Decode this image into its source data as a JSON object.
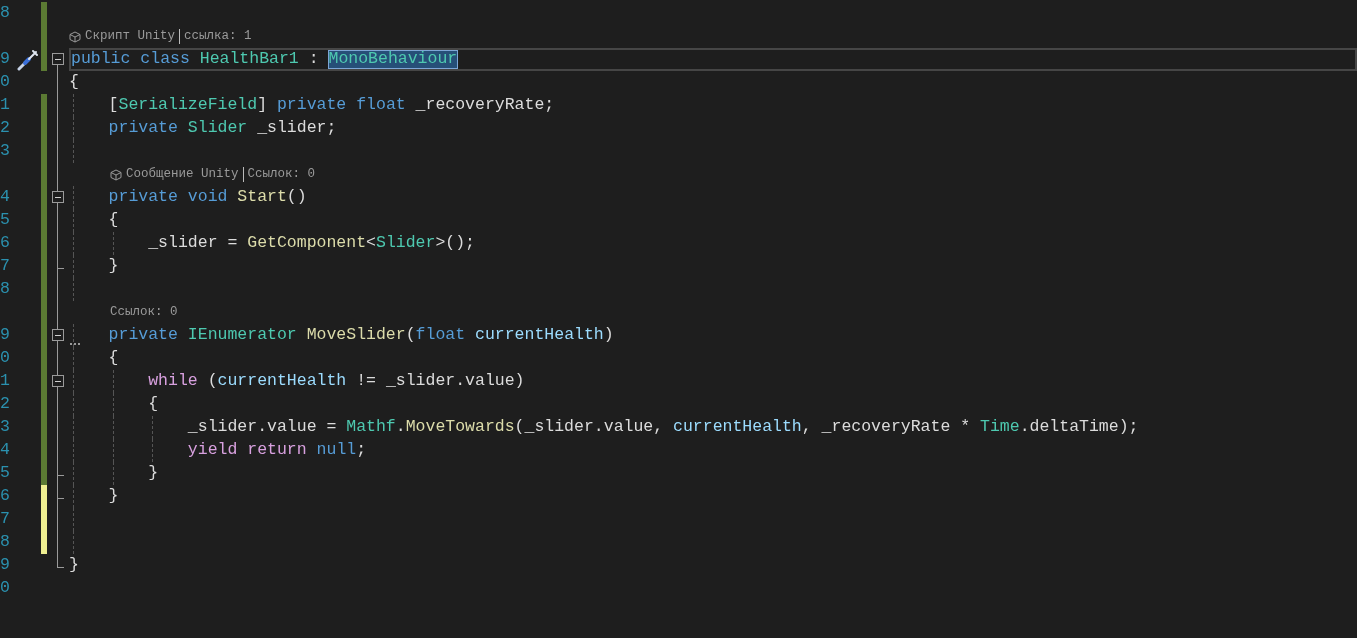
{
  "editor": {
    "rows": [
      {
        "kind": "code",
        "number": "8",
        "changed": true,
        "unsaved": false,
        "collapsible": false,
        "in_block": false,
        "block_end": false,
        "tokens": []
      },
      {
        "kind": "lens",
        "changed": true,
        "unsaved": false,
        "collapsible": false,
        "in_block": false,
        "block_end": false,
        "icon": true,
        "indented": false,
        "parts": [
          "Скрипт Unity",
          "ссылка: 1"
        ]
      },
      {
        "kind": "code",
        "number": "9",
        "changed": true,
        "unsaved": false,
        "collapsible": true,
        "in_block": false,
        "block_end": false,
        "current": true,
        "quick_action": true,
        "tokens": [
          {
            "kind": "keyword",
            "s": "public"
          },
          {
            "kind": "keyword",
            "s": " class"
          },
          {
            "kind": "type",
            "s": " HealthBar1"
          },
          {
            "kind": "plain",
            "s": " : "
          },
          {
            "kind": "type",
            "s": "MonoBehaviour",
            "highlighted": true
          }
        ]
      },
      {
        "kind": "code",
        "number": "0",
        "changed": false,
        "unsaved": false,
        "collapsible": false,
        "in_block": true,
        "block_end": false,
        "tokens": [
          {
            "kind": "plain",
            "s": "{"
          }
        ]
      },
      {
        "kind": "code",
        "number": "1",
        "changed": true,
        "unsaved": false,
        "collapsible": false,
        "in_block": true,
        "block_end": false,
        "tokens": [
          {
            "kind": "plain",
            "s": "    ["
          },
          {
            "kind": "type",
            "s": "SerializeField"
          },
          {
            "kind": "plain",
            "s": "]"
          },
          {
            "kind": "keyword",
            "s": " private"
          },
          {
            "kind": "keyword",
            "s": " float"
          },
          {
            "kind": "plain",
            "s": " _recoveryRate;"
          }
        ]
      },
      {
        "kind": "code",
        "number": "2",
        "changed": true,
        "unsaved": false,
        "collapsible": false,
        "in_block": true,
        "block_end": false,
        "tokens": [
          {
            "kind": "keyword",
            "s": "    private"
          },
          {
            "kind": "type",
            "s": " Slider"
          },
          {
            "kind": "plain",
            "s": " _slider;"
          }
        ]
      },
      {
        "kind": "code",
        "number": "3",
        "changed": true,
        "unsaved": false,
        "collapsible": false,
        "in_block": true,
        "block_end": false,
        "tokens": []
      },
      {
        "kind": "lens",
        "changed": true,
        "unsaved": false,
        "collapsible": false,
        "in_block": true,
        "block_end": false,
        "icon": true,
        "indented": true,
        "parts": [
          "Сообщение Unity",
          "Ссылок: 0"
        ]
      },
      {
        "kind": "code",
        "number": "4",
        "changed": true,
        "unsaved": false,
        "collapsible": true,
        "in_block": true,
        "block_end": false,
        "tokens": [
          {
            "kind": "keyword",
            "s": "    private"
          },
          {
            "kind": "keyword",
            "s": " void"
          },
          {
            "kind": "method",
            "s": " Start"
          },
          {
            "kind": "plain",
            "s": "()"
          }
        ]
      },
      {
        "kind": "code",
        "number": "5",
        "changed": true,
        "unsaved": false,
        "collapsible": false,
        "in_block": true,
        "block_end": false,
        "tokens": [
          {
            "kind": "plain",
            "s": "    {"
          }
        ]
      },
      {
        "kind": "code",
        "number": "6",
        "changed": true,
        "unsaved": false,
        "collapsible": false,
        "in_block": true,
        "block_end": false,
        "tokens": [
          {
            "kind": "plain",
            "s": "        _slider = "
          },
          {
            "kind": "method",
            "s": "GetComponent"
          },
          {
            "kind": "plain",
            "s": "<"
          },
          {
            "kind": "type",
            "s": "Slider"
          },
          {
            "kind": "plain",
            "s": ">();"
          }
        ]
      },
      {
        "kind": "code",
        "number": "7",
        "changed": true,
        "unsaved": false,
        "collapsible": false,
        "in_block": true,
        "block_end": true,
        "tokens": [
          {
            "kind": "plain",
            "s": "    }"
          }
        ]
      },
      {
        "kind": "code",
        "number": "8",
        "changed": true,
        "unsaved": false,
        "collapsible": false,
        "in_block": true,
        "block_end": false,
        "tokens": []
      },
      {
        "kind": "lens",
        "changed": true,
        "unsaved": false,
        "collapsible": false,
        "in_block": true,
        "block_end": false,
        "icon": false,
        "indented": true,
        "parts": [
          "Ссылок: 0"
        ]
      },
      {
        "kind": "code",
        "number": "9",
        "changed": true,
        "unsaved": false,
        "collapsible": true,
        "in_block": true,
        "block_end": false,
        "tokens": [
          {
            "kind": "keyword",
            "s": "    private"
          },
          {
            "kind": "type",
            "s": " IEnumerator"
          },
          {
            "kind": "method",
            "s": " MoveSlider",
            "suggestion": true
          },
          {
            "kind": "plain",
            "s": "("
          },
          {
            "kind": "keyword",
            "s": "float"
          },
          {
            "kind": "param",
            "s": " currentHealth"
          },
          {
            "kind": "plain",
            "s": ")"
          }
        ]
      },
      {
        "kind": "code",
        "number": "0",
        "changed": true,
        "unsaved": false,
        "collapsible": false,
        "in_block": true,
        "block_end": false,
        "tokens": [
          {
            "kind": "plain",
            "s": "    {"
          }
        ]
      },
      {
        "kind": "code",
        "number": "1",
        "changed": true,
        "unsaved": false,
        "collapsible": true,
        "in_block": true,
        "block_end": false,
        "tokens": [
          {
            "kind": "control",
            "s": "        while"
          },
          {
            "kind": "plain",
            "s": " ("
          },
          {
            "kind": "param",
            "s": "currentHealth"
          },
          {
            "kind": "plain",
            "s": " != _slider.value)"
          }
        ]
      },
      {
        "kind": "code",
        "number": "2",
        "changed": true,
        "unsaved": false,
        "collapsible": false,
        "in_block": true,
        "block_end": false,
        "tokens": [
          {
            "kind": "plain",
            "s": "        {"
          }
        ]
      },
      {
        "kind": "code",
        "number": "3",
        "changed": true,
        "unsaved": false,
        "collapsible": false,
        "in_block": true,
        "block_end": false,
        "tokens": [
          {
            "kind": "plain",
            "s": "            _slider.value = "
          },
          {
            "kind": "type",
            "s": "Mathf"
          },
          {
            "kind": "plain",
            "s": "."
          },
          {
            "kind": "method",
            "s": "MoveTowards"
          },
          {
            "kind": "plain",
            "s": "(_slider.value, "
          },
          {
            "kind": "param",
            "s": "currentHealth"
          },
          {
            "kind": "plain",
            "s": ", _recoveryRate * "
          },
          {
            "kind": "type",
            "s": "Time"
          },
          {
            "kind": "plain",
            "s": ".deltaTime);"
          }
        ]
      },
      {
        "kind": "code",
        "number": "4",
        "changed": true,
        "unsaved": false,
        "collapsible": false,
        "in_block": true,
        "block_end": false,
        "tokens": [
          {
            "kind": "control",
            "s": "            yield"
          },
          {
            "kind": "control",
            "s": " return"
          },
          {
            "kind": "keyword",
            "s": " null"
          },
          {
            "kind": "plain",
            "s": ";"
          }
        ]
      },
      {
        "kind": "code",
        "number": "5",
        "changed": true,
        "unsaved": false,
        "collapsible": false,
        "in_block": true,
        "block_end": true,
        "tokens": [
          {
            "kind": "plain",
            "s": "        }"
          }
        ]
      },
      {
        "kind": "code",
        "number": "6",
        "changed": true,
        "unsaved": true,
        "collapsible": false,
        "in_block": true,
        "block_end": true,
        "tokens": [
          {
            "kind": "plain",
            "s": "    }"
          }
        ]
      },
      {
        "kind": "code",
        "number": "7",
        "changed": true,
        "unsaved": true,
        "collapsible": false,
        "in_block": true,
        "block_end": false,
        "tokens": []
      },
      {
        "kind": "code",
        "number": "8",
        "changed": true,
        "unsaved": true,
        "collapsible": false,
        "in_block": true,
        "block_end": false,
        "tokens": []
      },
      {
        "kind": "code",
        "number": "9",
        "changed": false,
        "unsaved": false,
        "collapsible": false,
        "in_block": true,
        "block_end": true,
        "tokens": [
          {
            "kind": "plain",
            "s": "}"
          }
        ]
      },
      {
        "kind": "code",
        "number": "0",
        "changed": false,
        "unsaved": false,
        "collapsible": false,
        "in_block": false,
        "block_end": false,
        "tokens": []
      }
    ]
  }
}
